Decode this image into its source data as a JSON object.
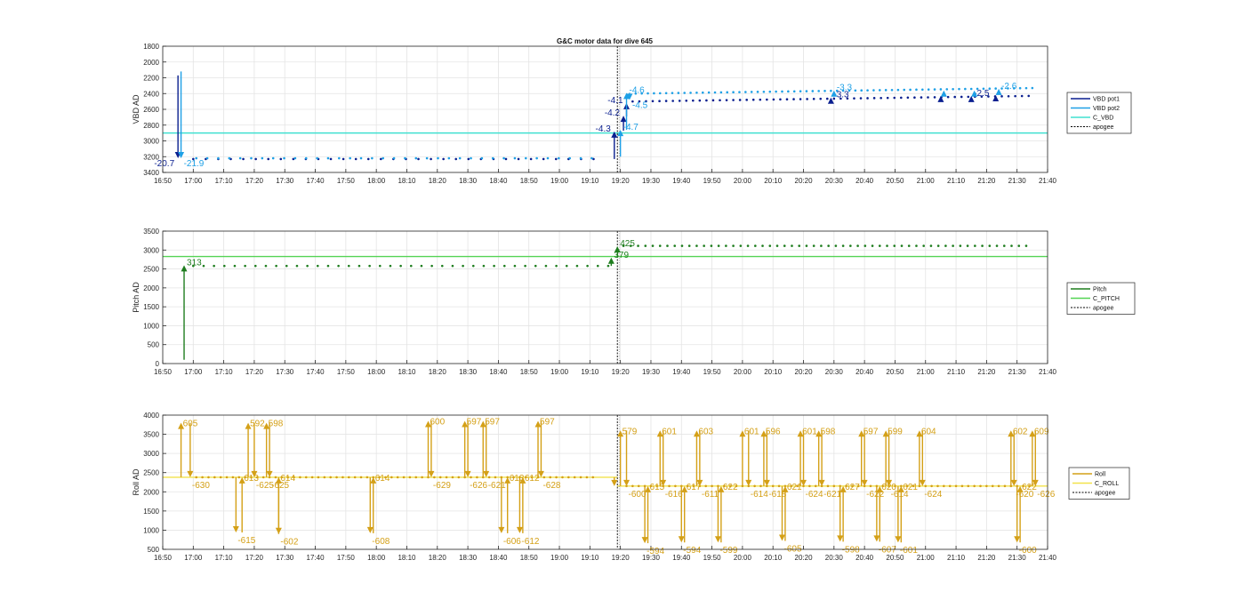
{
  "figure_title": "G&C motor data for dive 645",
  "colors": {
    "vbd_pot1": "#0a1f8f",
    "vbd_pot2": "#1ea0e6",
    "c_vbd": "#40e0d0",
    "pitch": "#1e7d1e",
    "c_pitch": "#54d454",
    "roll": "#d4a017",
    "c_roll": "#f2e24a",
    "apogee": "#000000",
    "grid": "#e4e4e4",
    "axis": "#262626"
  },
  "chart_data": [
    {
      "type": "line",
      "ylabel": "VBD AD",
      "xlim": [
        "16:50",
        "21:40"
      ],
      "xticks": [
        "16:50",
        "17:00",
        "17:10",
        "17:20",
        "17:30",
        "17:40",
        "17:50",
        "18:00",
        "18:10",
        "18:20",
        "18:30",
        "18:40",
        "18:50",
        "19:00",
        "19:10",
        "19:20",
        "19:30",
        "19:40",
        "19:50",
        "20:00",
        "20:10",
        "20:20",
        "20:30",
        "20:40",
        "20:50",
        "21:00",
        "21:10",
        "21:20",
        "21:30",
        "21:40"
      ],
      "ylim": [
        1800,
        3400
      ],
      "y_reversed": true,
      "yticks": [
        1800,
        2000,
        2200,
        2400,
        2600,
        2800,
        3000,
        3200,
        3400
      ],
      "grid": true,
      "legend": {
        "placement": "outside-right",
        "entries": [
          "VBD pot1",
          "VBD pot2",
          "C_VBD",
          "apogee"
        ]
      },
      "apogee_x": "19:19",
      "hline": {
        "name": "C_VBD",
        "y": 2900
      },
      "series": [
        {
          "name": "VBD pot1",
          "pre": {
            "start": "17:00",
            "end": "19:12",
            "step_min": 4.1,
            "y": 3230
          },
          "post": {
            "start": "19:24",
            "end": "21:34",
            "step_min": 2.2,
            "y": 2500,
            "y_end": 2430
          }
        },
        {
          "name": "VBD pot2",
          "pre": {
            "start": "17:01",
            "end": "19:13",
            "step_min": 3.6,
            "y": 3220
          },
          "post": {
            "start": "19:25",
            "end": "21:35",
            "step_min": 2.0,
            "y": 2400,
            "y_end": 2330
          }
        }
      ],
      "moves": [
        {
          "series": "VBD pot1",
          "x": "16:55",
          "y0": 2170,
          "y1": 3220,
          "label": "-20.7"
        },
        {
          "series": "VBD pot2",
          "x": "16:56",
          "y0": 2120,
          "y1": 3220,
          "label": "-21.9"
        },
        {
          "series": "VBD pot1",
          "x": "19:18",
          "y0": 3230,
          "y1": 2880,
          "label": "-4.3"
        },
        {
          "series": "VBD pot1",
          "x": "19:21",
          "y0": 2870,
          "y1": 2680,
          "label": "-4.2"
        },
        {
          "series": "VBD pot1",
          "x": "19:22",
          "y0": 2690,
          "y1": 2520,
          "label": "-4.1"
        },
        {
          "series": "VBD pot2",
          "x": "19:20",
          "y0": 3200,
          "y1": 2860,
          "label": "-4.7"
        },
        {
          "series": "VBD pot2",
          "x": "19:22",
          "y0": 2860,
          "y1": 2390,
          "label": "-4.6"
        },
        {
          "series": "VBD pot2",
          "x": "19:23",
          "y0": 2390,
          "y1": 2480,
          "label": "-4.5"
        },
        {
          "series": "VBD pot1",
          "x": "20:29",
          "y0": 2500,
          "y1": 2450,
          "label": "-3.3"
        },
        {
          "series": "VBD pot2",
          "x": "20:30",
          "y0": 2400,
          "y1": 2360,
          "label": "-3.3"
        },
        {
          "series": "VBD pot1",
          "x": "21:05",
          "y0": 2490,
          "y1": 2430,
          "label": ""
        },
        {
          "series": "VBD pot2",
          "x": "21:06",
          "y0": 2400,
          "y1": 2360,
          "label": ""
        },
        {
          "series": "VBD pot1",
          "x": "21:15",
          "y0": 2480,
          "y1": 2430,
          "label": "-2.5"
        },
        {
          "series": "VBD pot2",
          "x": "21:16",
          "y0": 2400,
          "y1": 2360,
          "label": ""
        },
        {
          "series": "VBD pot1",
          "x": "21:23",
          "y0": 2470,
          "y1": 2420,
          "label": ""
        },
        {
          "series": "VBD pot2",
          "x": "21:24",
          "y0": 2380,
          "y1": 2340,
          "label": "-2.6"
        }
      ]
    },
    {
      "type": "line",
      "ylabel": "Pitch AD",
      "xlim": [
        "16:50",
        "21:40"
      ],
      "xticks": [
        "16:50",
        "17:00",
        "17:10",
        "17:20",
        "17:30",
        "17:40",
        "17:50",
        "18:00",
        "18:10",
        "18:20",
        "18:30",
        "18:40",
        "18:50",
        "19:00",
        "19:10",
        "19:20",
        "19:30",
        "19:40",
        "19:50",
        "20:00",
        "20:10",
        "20:20",
        "20:30",
        "20:40",
        "20:50",
        "21:00",
        "21:10",
        "21:20",
        "21:30",
        "21:40"
      ],
      "ylim": [
        0,
        3500
      ],
      "y_reversed": false,
      "yticks": [
        0,
        500,
        1000,
        1500,
        2000,
        2500,
        3000,
        3500
      ],
      "grid": true,
      "legend": {
        "placement": "outside-right",
        "entries": [
          "Pitch",
          "C_PITCH",
          "apogee"
        ]
      },
      "apogee_x": "19:19",
      "hline": {
        "name": "C_PITCH",
        "y": 2830
      },
      "series": [
        {
          "name": "Pitch",
          "pre": {
            "start": "17:00",
            "end": "19:17",
            "step_min": 3.4,
            "y": 2580
          },
          "post": {
            "start": "19:21",
            "end": "21:35",
            "step_min": 2.4,
            "y": 3110,
            "y_end": 3110
          }
        }
      ],
      "moves": [
        {
          "series": "Pitch",
          "x": "16:57",
          "y0": 100,
          "y1": 2600,
          "label": "313"
        },
        {
          "series": "Pitch",
          "x": "19:17",
          "y0": 2580,
          "y1": 2800,
          "label": "379"
        },
        {
          "series": "Pitch",
          "x": "19:19",
          "y0": 2800,
          "y1": 3100,
          "label": "425"
        }
      ]
    },
    {
      "type": "line",
      "ylabel": "Roll AD",
      "xlim": [
        "16:50",
        "21:40"
      ],
      "xticks": [
        "16:50",
        "17:00",
        "17:10",
        "17:20",
        "17:30",
        "17:40",
        "17:50",
        "18:00",
        "18:10",
        "18:20",
        "18:30",
        "18:40",
        "18:50",
        "19:00",
        "19:10",
        "19:20",
        "19:30",
        "19:40",
        "19:50",
        "20:00",
        "20:10",
        "20:20",
        "20:30",
        "20:40",
        "20:50",
        "21:00",
        "21:10",
        "21:20",
        "21:30",
        "21:40"
      ],
      "ylim": [
        500,
        4000
      ],
      "y_reversed": false,
      "yticks": [
        500,
        1000,
        1500,
        2000,
        2500,
        3000,
        3500,
        4000
      ],
      "grid": true,
      "legend": {
        "placement": "outside-right",
        "entries": [
          "Roll",
          "C_ROLL",
          "apogee"
        ]
      },
      "apogee_x": "19:19",
      "hline": {
        "name": "C_ROLL",
        "y": 2380,
        "y_post": 2150
      },
      "series": [
        {
          "name": "Roll",
          "pre": {
            "start": "17:01",
            "end": "19:12",
            "step_min": 2.0,
            "y": 2380
          },
          "post": {
            "start": "19:22",
            "end": "21:35",
            "step_min": 2.0,
            "y": 2150,
            "y_end": 2150
          }
        }
      ],
      "moves": [
        {
          "x": "16:56",
          "y0": 2380,
          "y1": 3800,
          "label": "605"
        },
        {
          "x": "16:59",
          "y0": 3800,
          "y1": 2380,
          "label": "-630"
        },
        {
          "x": "17:14",
          "y0": 2380,
          "y1": 940,
          "label": "-615"
        },
        {
          "x": "17:16",
          "y0": 940,
          "y1": 2380,
          "label": "613"
        },
        {
          "x": "17:18",
          "y0": 2380,
          "y1": 3800,
          "label": "592"
        },
        {
          "x": "17:20",
          "y0": 3800,
          "y1": 2380,
          "label": "-625"
        },
        {
          "x": "17:24",
          "y0": 2380,
          "y1": 3800,
          "label": "598"
        },
        {
          "x": "17:25",
          "y0": 3800,
          "y1": 2380,
          "label": "-625"
        },
        {
          "x": "17:28",
          "y0": 2380,
          "y1": 900,
          "label": "-602"
        },
        {
          "x": "17:28",
          "y0": 900,
          "y1": 2380,
          "label": "614"
        },
        {
          "x": "17:58",
          "y0": 2380,
          "y1": 920,
          "label": "-608"
        },
        {
          "x": "17:59",
          "y0": 920,
          "y1": 2380,
          "label": "614"
        },
        {
          "x": "18:17",
          "y0": 2380,
          "y1": 3850,
          "label": "600"
        },
        {
          "x": "18:18",
          "y0": 3850,
          "y1": 2380,
          "label": "-629"
        },
        {
          "x": "18:29",
          "y0": 2380,
          "y1": 3850,
          "label": "597"
        },
        {
          "x": "18:30",
          "y0": 3850,
          "y1": 2380,
          "label": "-626"
        },
        {
          "x": "18:35",
          "y0": 2380,
          "y1": 3850,
          "label": "597"
        },
        {
          "x": "18:36",
          "y0": 3850,
          "y1": 2380,
          "label": "-621"
        },
        {
          "x": "18:41",
          "y0": 2380,
          "y1": 920,
          "label": "-606"
        },
        {
          "x": "18:43",
          "y0": 920,
          "y1": 2380,
          "label": "613"
        },
        {
          "x": "18:47",
          "y0": 2380,
          "y1": 920,
          "label": "-612"
        },
        {
          "x": "18:48",
          "y0": 920,
          "y1": 2380,
          "label": "612"
        },
        {
          "x": "18:53",
          "y0": 2380,
          "y1": 3850,
          "label": "597"
        },
        {
          "x": "18:54",
          "y0": 3850,
          "y1": 2380,
          "label": "-628"
        },
        {
          "x": "19:18",
          "y0": 2380,
          "y1": 2150,
          "label": ""
        },
        {
          "x": "19:20",
          "y0": 2150,
          "y1": 3600,
          "label": "579"
        },
        {
          "x": "19:22",
          "y0": 3600,
          "y1": 2150,
          "label": "-600"
        },
        {
          "x": "19:28",
          "y0": 2150,
          "y1": 660,
          "label": "-594"
        },
        {
          "x": "19:29",
          "y0": 660,
          "y1": 2150,
          "label": "615"
        },
        {
          "x": "19:33",
          "y0": 2150,
          "y1": 3600,
          "label": "601"
        },
        {
          "x": "19:34",
          "y0": 3600,
          "y1": 2150,
          "label": "-616"
        },
        {
          "x": "19:40",
          "y0": 2150,
          "y1": 680,
          "label": "-594"
        },
        {
          "x": "19:41",
          "y0": 680,
          "y1": 2150,
          "label": "617"
        },
        {
          "x": "19:45",
          "y0": 2150,
          "y1": 3600,
          "label": "603"
        },
        {
          "x": "19:46",
          "y0": 3600,
          "y1": 2150,
          "label": "-611"
        },
        {
          "x": "19:52",
          "y0": 2150,
          "y1": 680,
          "label": "-599"
        },
        {
          "x": "19:53",
          "y0": 680,
          "y1": 2150,
          "label": "622"
        },
        {
          "x": "20:00",
          "y0": 2150,
          "y1": 3600,
          "label": "601"
        },
        {
          "x": "20:02",
          "y0": 3600,
          "y1": 2150,
          "label": "-614"
        },
        {
          "x": "20:07",
          "y0": 2150,
          "y1": 3600,
          "label": "596"
        },
        {
          "x": "20:08",
          "y0": 3600,
          "y1": 2150,
          "label": "-618"
        },
        {
          "x": "20:13",
          "y0": 2150,
          "y1": 720,
          "label": "-605"
        },
        {
          "x": "20:14",
          "y0": 720,
          "y1": 2150,
          "label": "621"
        },
        {
          "x": "20:19",
          "y0": 2150,
          "y1": 3600,
          "label": "601"
        },
        {
          "x": "20:20",
          "y0": 3600,
          "y1": 2150,
          "label": "-624"
        },
        {
          "x": "20:25",
          "y0": 2150,
          "y1": 3600,
          "label": "598"
        },
        {
          "x": "20:26",
          "y0": 3600,
          "y1": 2150,
          "label": "-621"
        },
        {
          "x": "20:32",
          "y0": 2150,
          "y1": 700,
          "label": "-598"
        },
        {
          "x": "20:33",
          "y0": 700,
          "y1": 2150,
          "label": "627"
        },
        {
          "x": "20:39",
          "y0": 2150,
          "y1": 3600,
          "label": "597"
        },
        {
          "x": "20:40",
          "y0": 3600,
          "y1": 2150,
          "label": "-622"
        },
        {
          "x": "20:44",
          "y0": 2150,
          "y1": 700,
          "label": "-607"
        },
        {
          "x": "20:45",
          "y0": 700,
          "y1": 2150,
          "label": "620"
        },
        {
          "x": "20:47",
          "y0": 2150,
          "y1": 3600,
          "label": "599"
        },
        {
          "x": "20:48",
          "y0": 3600,
          "y1": 2150,
          "label": "-614"
        },
        {
          "x": "20:51",
          "y0": 2150,
          "y1": 680,
          "label": "-601"
        },
        {
          "x": "20:52",
          "y0": 680,
          "y1": 2150,
          "label": "621"
        },
        {
          "x": "20:58",
          "y0": 2150,
          "y1": 3600,
          "label": "604"
        },
        {
          "x": "20:59",
          "y0": 3600,
          "y1": 2150,
          "label": "-624"
        },
        {
          "x": "21:28",
          "y0": 2150,
          "y1": 3600,
          "label": "602"
        },
        {
          "x": "21:29",
          "y0": 3600,
          "y1": 2150,
          "label": "-620"
        },
        {
          "x": "21:30",
          "y0": 2150,
          "y1": 680,
          "label": "-600"
        },
        {
          "x": "21:31",
          "y0": 680,
          "y1": 2150,
          "label": "622"
        },
        {
          "x": "21:35",
          "y0": 2150,
          "y1": 3600,
          "label": "609"
        },
        {
          "x": "21:36",
          "y0": 3600,
          "y1": 2150,
          "label": "-626"
        }
      ]
    }
  ]
}
